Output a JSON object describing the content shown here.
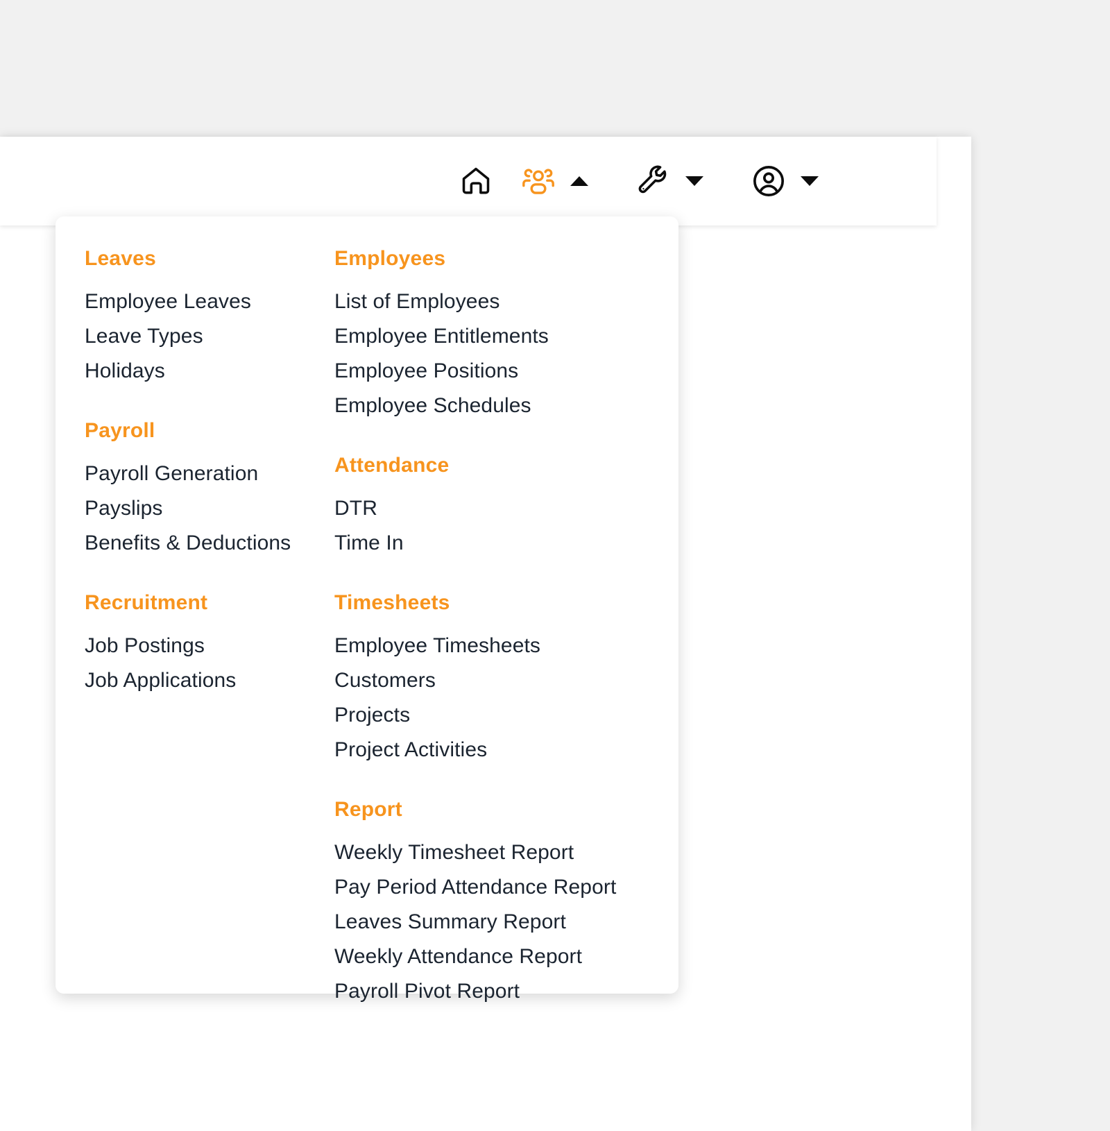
{
  "theme": {
    "accent": "#f7941e",
    "text": "#1b2430",
    "page_bg": "#f1f1f1",
    "surface": "#ffffff"
  },
  "navbar": {
    "items": [
      {
        "name": "home-icon",
        "icon": "home",
        "active": false,
        "caret": null
      },
      {
        "name": "people-icon",
        "icon": "people",
        "active": true,
        "caret": "up"
      },
      {
        "name": "wrench-icon",
        "icon": "wrench",
        "active": false,
        "caret": "down"
      },
      {
        "name": "account-icon",
        "icon": "account",
        "active": false,
        "caret": "down"
      }
    ]
  },
  "mega_menu": {
    "columns": [
      {
        "id": "left",
        "sections": [
          {
            "title": "Leaves",
            "items": [
              "Employee Leaves",
              "Leave Types",
              "Holidays"
            ]
          },
          {
            "title": "Payroll",
            "items": [
              "Payroll Generation",
              "Payslips",
              "Benefits & Deductions"
            ]
          },
          {
            "title": "Recruitment",
            "items": [
              "Job Postings",
              "Job Applications"
            ]
          }
        ]
      },
      {
        "id": "right",
        "sections": [
          {
            "title": "Employees",
            "items": [
              "List of Employees",
              "Employee Entitlements",
              "Employee Positions",
              "Employee Schedules"
            ]
          },
          {
            "title": "Attendance",
            "items": [
              "DTR",
              "Time In"
            ]
          },
          {
            "title": "Timesheets",
            "items": [
              "Employee Timesheets",
              "Customers",
              "Projects",
              "Project Activities"
            ]
          },
          {
            "title": "Report",
            "items": [
              "Weekly Timesheet Report",
              "Pay Period Attendance Report",
              "Leaves Summary Report",
              "Weekly Attendance Report",
              "Payroll Pivot Report"
            ]
          }
        ]
      }
    ]
  }
}
